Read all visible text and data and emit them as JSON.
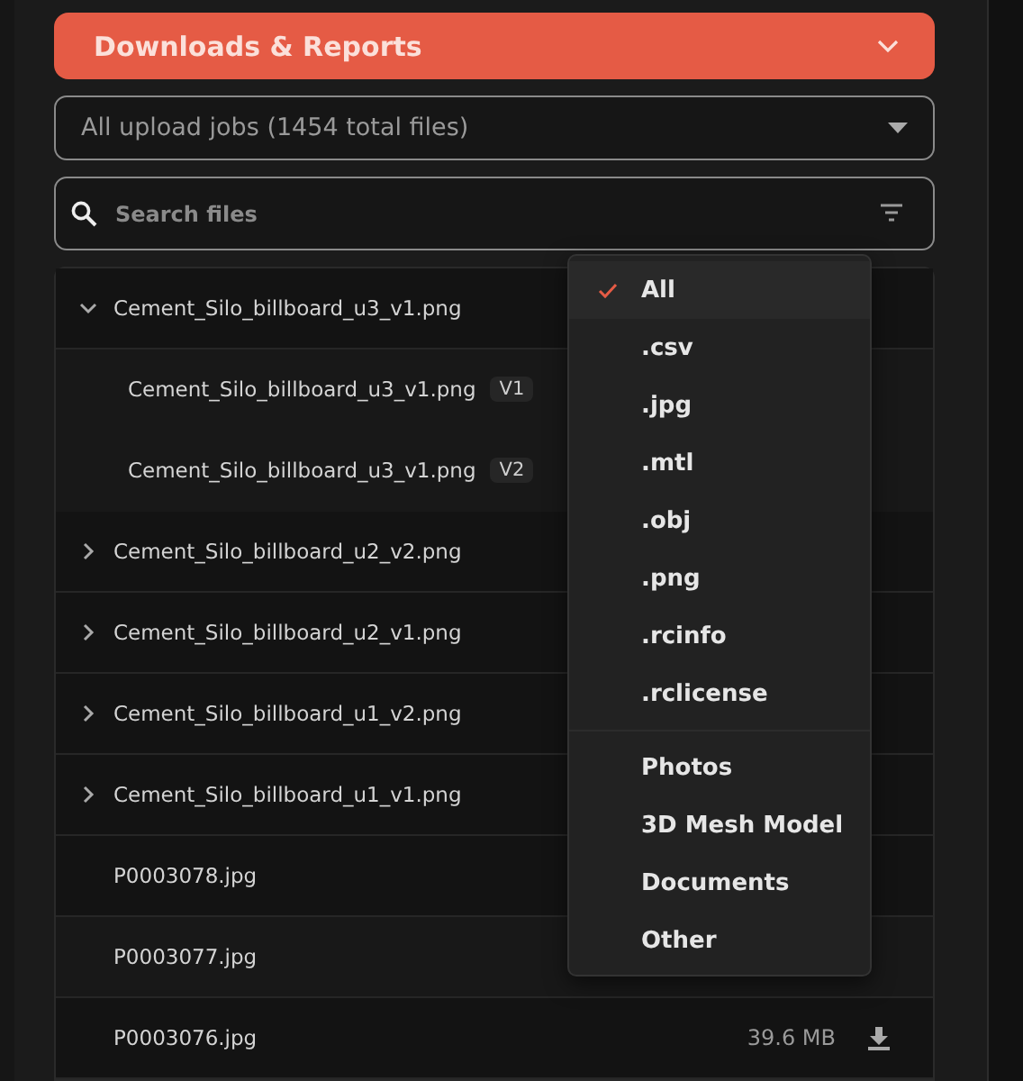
{
  "header": {
    "title": "Downloads & Reports",
    "expanded": true
  },
  "job_select": {
    "value": "All upload jobs (1454 total files)"
  },
  "search": {
    "placeholder": "Search files"
  },
  "files": [
    {
      "kind": "group",
      "name": "Cement_Silo_billboard_u3_v1.png",
      "expanded": true,
      "children": [
        {
          "name": "Cement_Silo_billboard_u3_v1.png",
          "version": "V1"
        },
        {
          "name": "Cement_Silo_billboard_u3_v1.png",
          "version": "V2"
        }
      ]
    },
    {
      "kind": "group",
      "name": "Cement_Silo_billboard_u2_v2.png",
      "expanded": false
    },
    {
      "kind": "group",
      "name": "Cement_Silo_billboard_u2_v1.png",
      "expanded": false
    },
    {
      "kind": "group",
      "name": "Cement_Silo_billboard_u1_v2.png",
      "expanded": false
    },
    {
      "kind": "group",
      "name": "Cement_Silo_billboard_u1_v1.png",
      "expanded": false
    },
    {
      "kind": "file",
      "name": "P0003078.jpg"
    },
    {
      "kind": "file",
      "name": "P0003077.jpg"
    },
    {
      "kind": "file",
      "name": "P0003076.jpg",
      "size": "39.6 MB"
    }
  ],
  "filter_menu": {
    "sections": [
      [
        {
          "label": "All",
          "selected": true
        },
        {
          "label": ".csv",
          "selected": false
        },
        {
          "label": ".jpg",
          "selected": false
        },
        {
          "label": ".mtl",
          "selected": false
        },
        {
          "label": ".obj",
          "selected": false
        },
        {
          "label": ".png",
          "selected": false
        },
        {
          "label": ".rcinfo",
          "selected": false
        },
        {
          "label": ".rclicense",
          "selected": false
        }
      ],
      [
        {
          "label": "Photos",
          "selected": false
        },
        {
          "label": "3D Mesh Model",
          "selected": false
        },
        {
          "label": "Documents",
          "selected": false
        },
        {
          "label": "Other",
          "selected": false
        }
      ]
    ]
  }
}
